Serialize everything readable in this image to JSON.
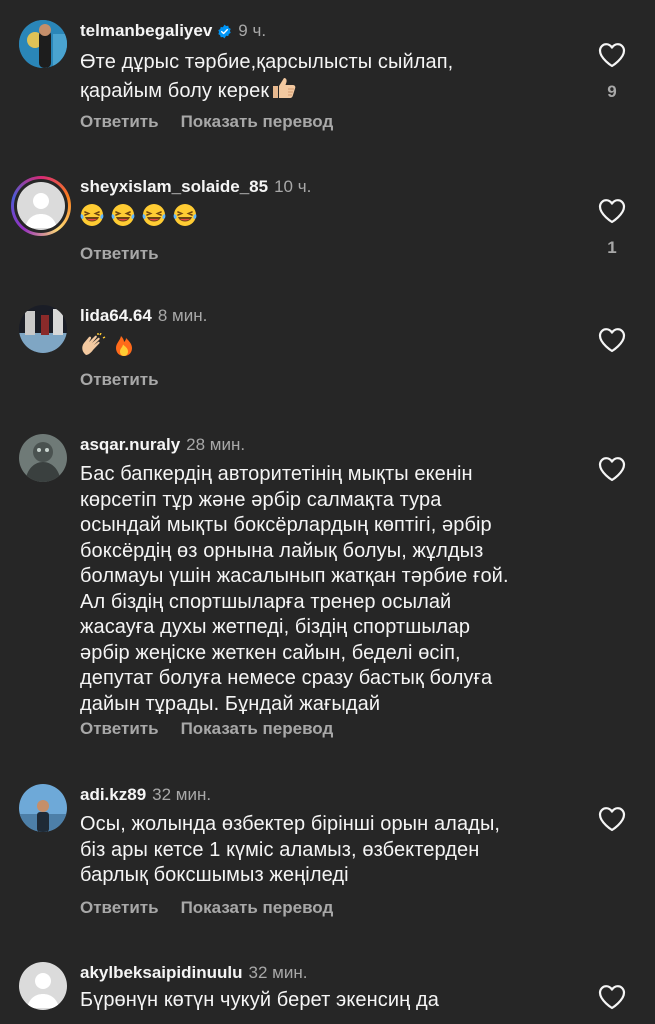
{
  "colors": {
    "background": "#262626",
    "text_primary": "#f5f5f5",
    "text_secondary": "#a8a8a8",
    "verified": "#0095f6"
  },
  "actions": {
    "reply": "Ответить",
    "translate": "Показать перевод"
  },
  "comments": [
    {
      "username": "telmanbegaliyev",
      "verified": true,
      "time": "9 ч.",
      "text_line1": "Өте дұрыс тәрбие,қарсылысты сыйлап,",
      "text_line2": "қарайым болу керек",
      "emoji": "thumbs-up",
      "like_count": "9"
    },
    {
      "username": "sheyxislam_solaide_85",
      "time": "10 ч.",
      "emoji": "laughing-crying x4",
      "like_count": "1"
    },
    {
      "username": "lida64.64",
      "time": "8 мин.",
      "emoji": "clapping, fire"
    },
    {
      "username": "asqar.nuraly",
      "time": "28 мин.",
      "lines": [
        "Бас бапкердің авторитетінің мықты екенін",
        "көрсетіп тұр және әрбір салмақта тура",
        "осындай мықты боксёрлардың көптігі, әрбір",
        "боксёрдің өз орнына лайық болуы, жұлдыз",
        "болмауы үшін жасалынып жатқан тәрбие ғой.",
        "Ал біздің спортшыларға тренер осылай",
        "жасауға духы жетпеді, біздің спортшылар",
        "әрбір жеңіске жеткен сайын, беделі өсіп,",
        "депутат болуға немесе сразу бастық болуға",
        "дайын тұрады. Бұндай жағыдай"
      ]
    },
    {
      "username": "adi.kz89",
      "time": "32 мин.",
      "lines": [
        "Осы, жолында өзбектер бірінші орын алады,",
        "біз ары кетсе 1 күміс аламыз, өзбектерден",
        "барлық боксшымыз жеңіледі"
      ]
    },
    {
      "username": "akylbeksaipidinuulu",
      "time": "32 мин.",
      "lines": [
        "Бүрөнүн көтүн чукуй берет экенсиң да"
      ]
    }
  ]
}
